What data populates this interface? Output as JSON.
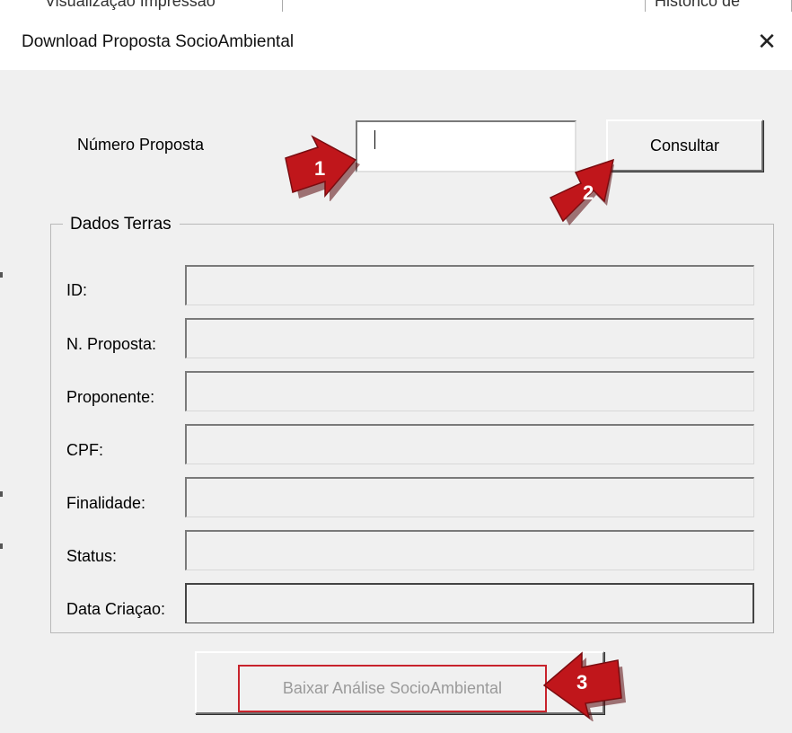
{
  "background": {
    "tab_left": "Visualização Impressão",
    "tab_right": "Histórico de"
  },
  "window": {
    "title": "Download Proposta SocioAmbiental",
    "close_glyph": "✕",
    "close_icon": "close-icon"
  },
  "search": {
    "label": "Número Proposta",
    "value": "",
    "consult_label": "Consultar"
  },
  "group": {
    "title": "Dados Terras",
    "fields": [
      {
        "label": "ID:",
        "value": ""
      },
      {
        "label": "N. Proposta:",
        "value": ""
      },
      {
        "label": "Proponente:",
        "value": ""
      },
      {
        "label": "CPF:",
        "value": ""
      },
      {
        "label": "Finalidade:",
        "value": ""
      },
      {
        "label": "Status:",
        "value": ""
      },
      {
        "label": "Data Criaçao:",
        "value": ""
      }
    ]
  },
  "download": {
    "label": "Baixar Análise SocioAmbiental"
  },
  "annotations": {
    "arrow_color": "#c0161b",
    "step_1": "1",
    "step_2": "2",
    "step_3": "3"
  }
}
